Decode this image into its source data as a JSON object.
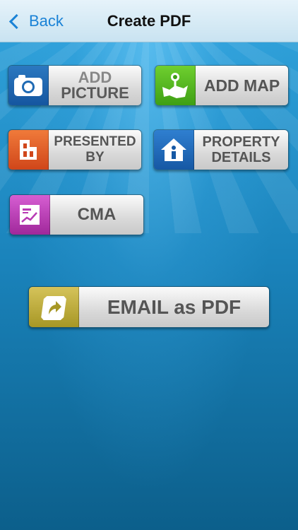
{
  "nav": {
    "back_label": "Back",
    "title": "Create PDF"
  },
  "tiles": {
    "add_picture": {
      "line1": "ADD",
      "line2": "PICTURE",
      "icon": "camera-icon",
      "color": "#1f6ab3"
    },
    "add_map": {
      "label": "ADD MAP",
      "icon": "map-pin-icon",
      "color": "#55b322"
    },
    "presented_by": {
      "line1": "PRESENTED",
      "line2": "BY",
      "icon": "presenter-icon",
      "color": "#e35a26"
    },
    "property_details": {
      "line1": "PROPERTY",
      "line2": "DETAILS",
      "icon": "house-info-icon",
      "color": "#1f6ab3"
    },
    "cma": {
      "label": "CMA",
      "icon": "chart-icon",
      "color": "#b83ab4"
    },
    "email_pdf": {
      "label": "EMAIL as PDF",
      "icon": "share-arrow-icon",
      "color": "#bba83b"
    }
  }
}
